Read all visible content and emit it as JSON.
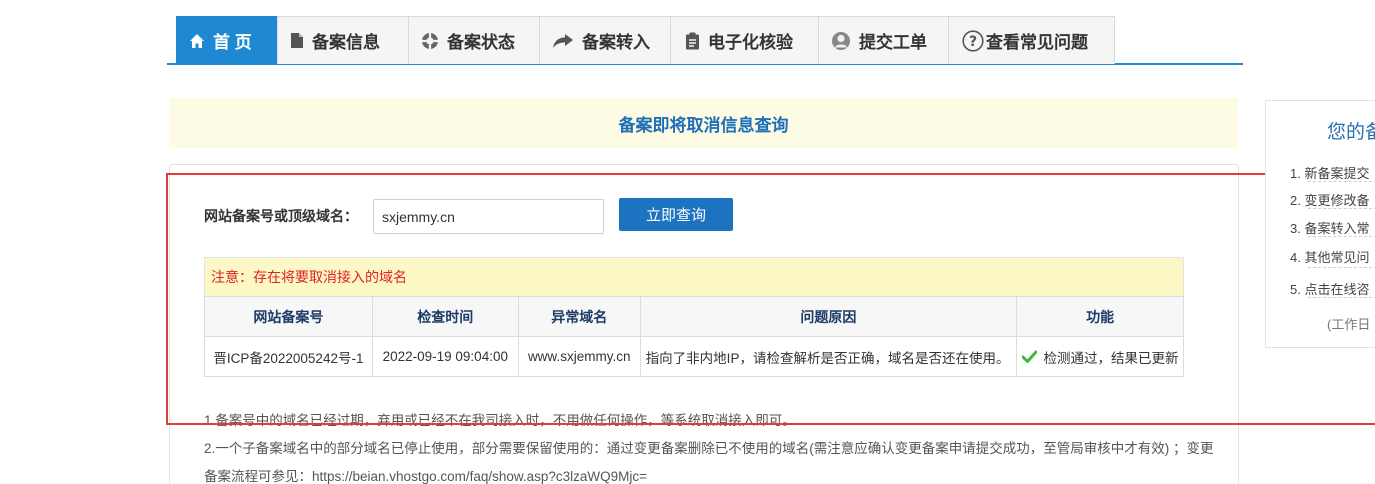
{
  "nav": {
    "tabs": [
      {
        "label": "首 页",
        "icon": "home-icon",
        "active": true
      },
      {
        "label": "备案信息",
        "icon": "document-icon"
      },
      {
        "label": "备案状态",
        "icon": "lifebuoy-icon"
      },
      {
        "label": "备案转入",
        "icon": "share-arrow-icon"
      },
      {
        "label": "电子化核验",
        "icon": "clipboard-icon"
      },
      {
        "label": "提交工单",
        "icon": "user-icon"
      },
      {
        "label": "查看常见问题",
        "icon": "question-icon"
      }
    ]
  },
  "page_title": "备案即将取消信息查询",
  "query": {
    "label": "网站备案号或顶级域名：",
    "value": "sxjemmy.cn",
    "button": "立即查询"
  },
  "notice": "注意：存在将要取消接入的域名",
  "table": {
    "headers": [
      "网站备案号",
      "检查时间",
      "异常域名",
      "问题原因",
      "功能"
    ],
    "rows": [
      [
        "晋ICP备2022005242号-1",
        "2022-09-19 09:04:00",
        "www.sxjemmy.cn",
        "指向了非内地IP，请检查解析是否正确，域名是否还在使用。",
        "检测通过，结果已更新"
      ]
    ]
  },
  "notes": [
    "1.备案号中的域名已经过期，弃用或已经不在我司接入时，不用做任何操作，等系统取消接入即可。",
    "2.一个子备案域名中的部分域名已停止使用，部分需要保留使用的：通过变更备案删除已不使用的域名(需注意应确认变更备案申请提交成功，至管局审核中才有效) ；变更",
    "备案流程可参见：https://beian.vhostgo.com/faq/show.asp?c3lzaWQ9Mjc="
  ],
  "side": {
    "title": "您的备",
    "items": [
      "1. 新备案提交",
      "2. 变更修改备",
      "3. 备案转入常",
      "4. 其他常见问",
      "5. 点击在线咨"
    ],
    "footer": "(工作日"
  },
  "colors": {
    "accent": "#1e88d2",
    "button": "#1d73c0",
    "notice_bg": "#fcf8c5",
    "notice_text": "#e02222",
    "highlight": "#e53a3a"
  }
}
